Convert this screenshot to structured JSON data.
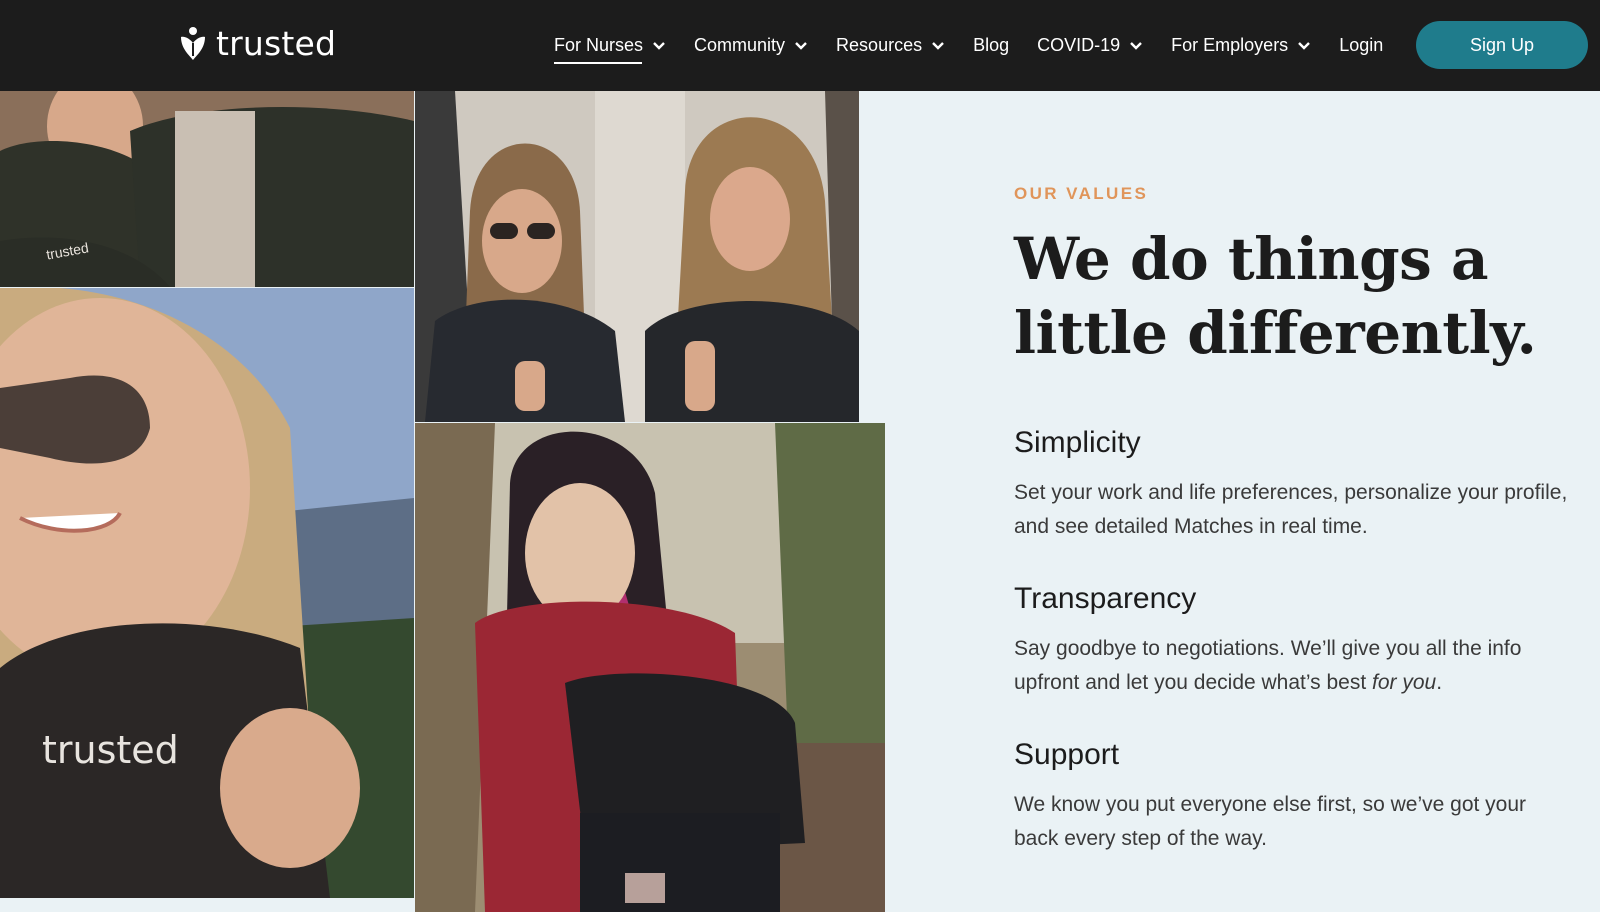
{
  "brand": {
    "name": "trusted"
  },
  "nav": {
    "items": [
      {
        "label": "For Nurses",
        "has_dropdown": true,
        "active": true
      },
      {
        "label": "Community",
        "has_dropdown": true,
        "active": false
      },
      {
        "label": "Resources",
        "has_dropdown": true,
        "active": false
      },
      {
        "label": "Blog",
        "has_dropdown": false,
        "active": false
      },
      {
        "label": "COVID-19",
        "has_dropdown": true,
        "active": false
      },
      {
        "label": "For Employers",
        "has_dropdown": true,
        "active": false
      },
      {
        "label": "Login",
        "has_dropdown": false,
        "active": false
      }
    ],
    "signup_label": "Sign Up",
    "icon": "chevron-down-icon"
  },
  "photos": {
    "photo1_text": "trusted",
    "photo3_logo_text": "trusted"
  },
  "values": {
    "eyebrow": "OUR VALUES",
    "headline_line1": "We do things a",
    "headline_line2": "little differently.",
    "items": [
      {
        "title": "Simplicity",
        "body": "Set your work and life preferences, personalize your profile, and see detailed Matches in real time."
      },
      {
        "title": "Transparency",
        "body_main": "Say goodbye to negotiations. We’ll give you all the info upfront and let you decide what’s best ",
        "body_emph": "for you",
        "body_end": "."
      },
      {
        "title": "Support",
        "body": "We know you put everyone else first, so we’ve got your back every step of the way."
      }
    ]
  },
  "colors": {
    "topbar": "#1c1c1c",
    "accent": "#1f7c8c",
    "eyebrow": "#e0955a",
    "page_bg": "#eaf2f5"
  }
}
